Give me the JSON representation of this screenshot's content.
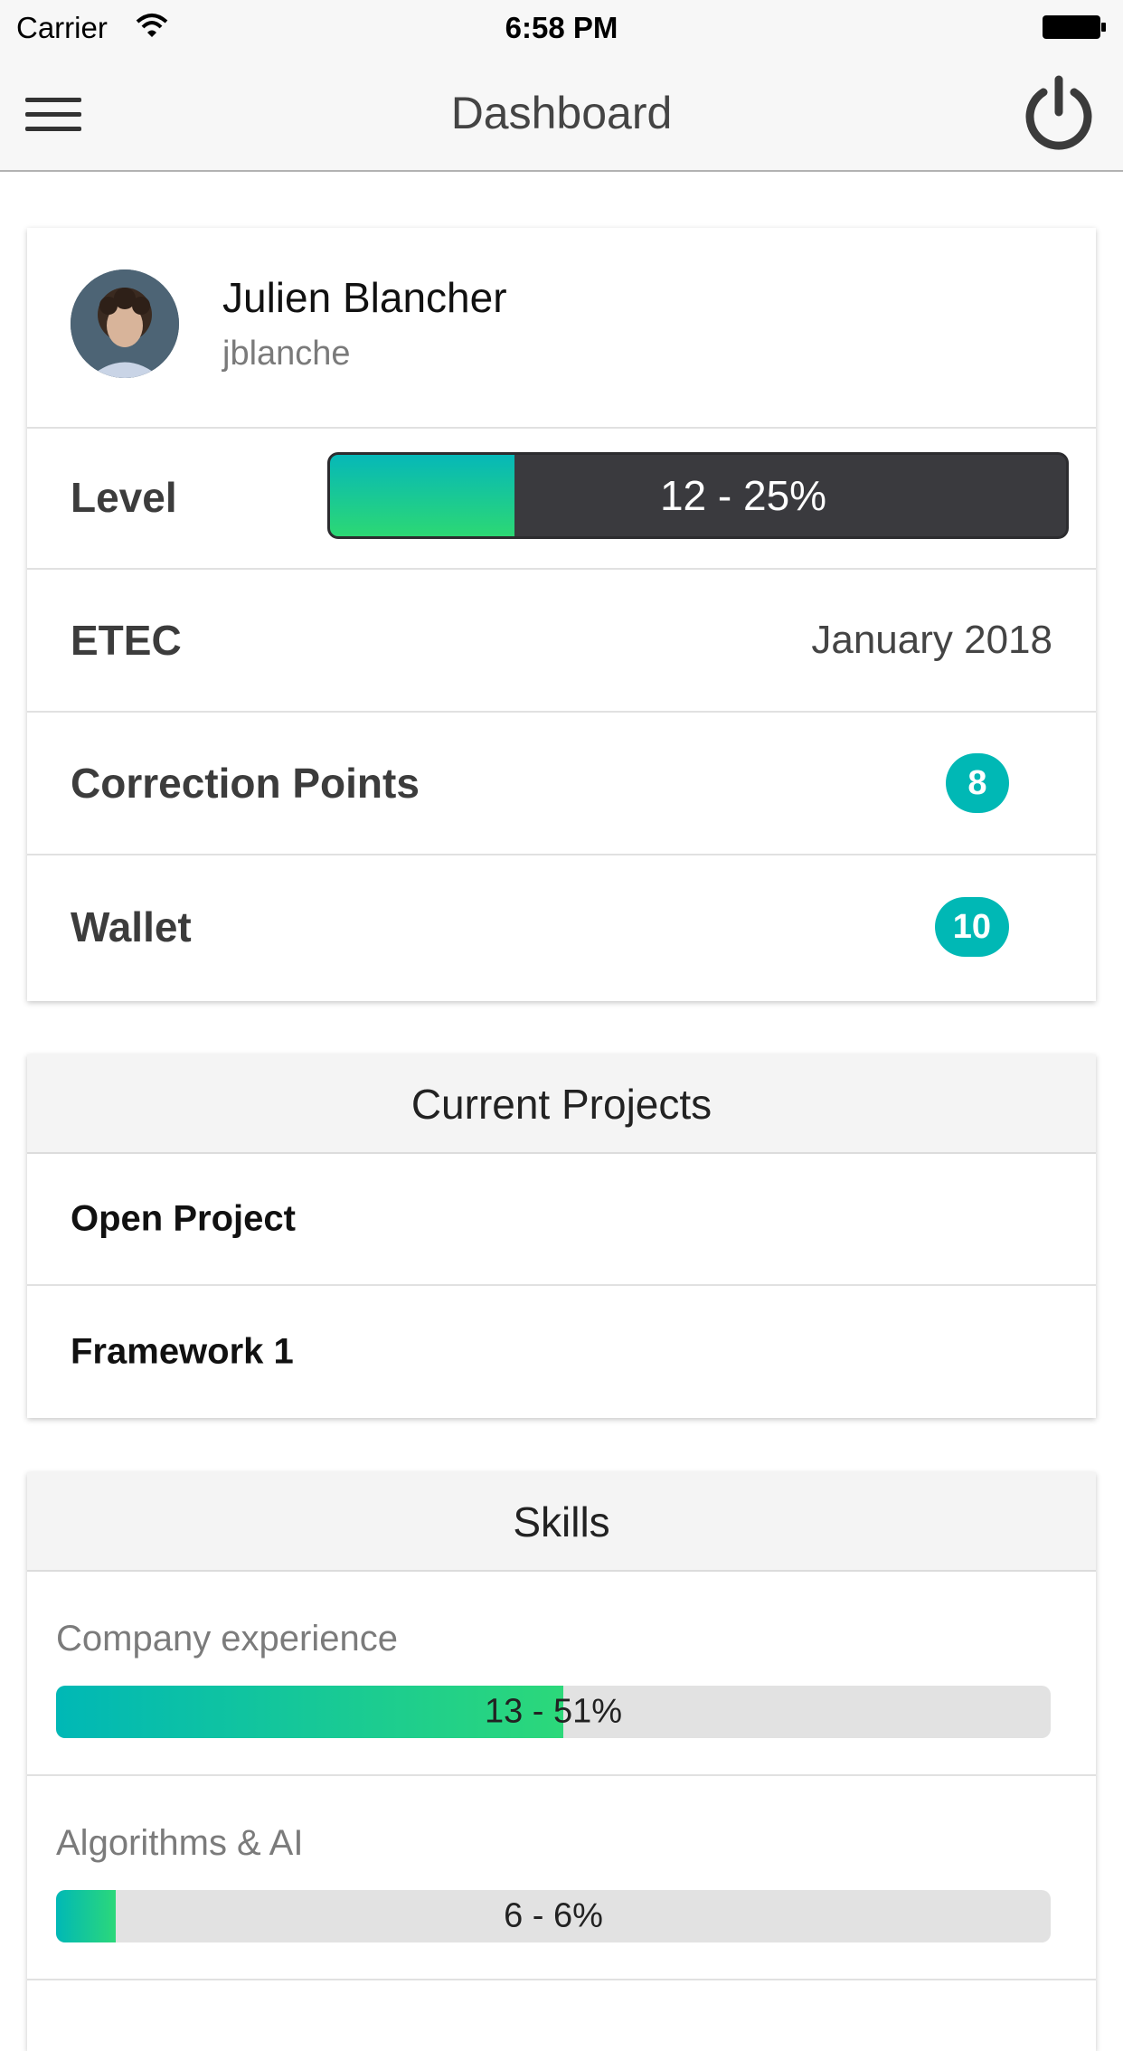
{
  "status_bar": {
    "carrier": "Carrier",
    "time": "6:58 PM"
  },
  "nav": {
    "title": "Dashboard",
    "menu_icon": "hamburger-menu-icon",
    "power_icon": "power-icon"
  },
  "profile": {
    "name": "Julien Blancher",
    "login": "jblanche",
    "level": {
      "label": "Level",
      "text": "12 - 25%",
      "progress_percent": 25
    },
    "etec": {
      "label": "ETEC",
      "value": "January 2018"
    },
    "correction_points": {
      "label": "Correction Points",
      "value": "8"
    },
    "wallet": {
      "label": "Wallet",
      "value": "10"
    }
  },
  "projects": {
    "title": "Current Projects",
    "items": [
      {
        "label": "Open Project"
      },
      {
        "label": "Framework 1"
      }
    ]
  },
  "skills": {
    "title": "Skills",
    "items": [
      {
        "label": "Company experience",
        "text": "13 - 51%",
        "progress_percent": 51
      },
      {
        "label": "Algorithms & AI",
        "text": "6 - 6%",
        "progress_percent": 6
      }
    ]
  },
  "colors": {
    "accent": "#00b8b5",
    "gradient_end": "#2cd874",
    "level_bar_bg": "#3a3a3e"
  }
}
